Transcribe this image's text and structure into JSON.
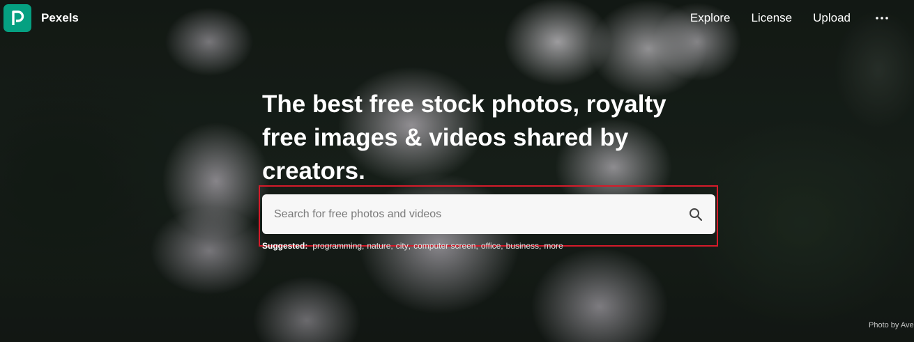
{
  "brand": {
    "name": "Pexels",
    "logo_icon": "pexels-logo-icon",
    "accent": "#05a081"
  },
  "nav": {
    "links": [
      "Explore",
      "License",
      "Upload"
    ],
    "more_icon": "more-horizontal-icon"
  },
  "hero": {
    "headline_lines": [
      "The best free stock photos, royalty",
      "free images & videos shared by",
      "creators."
    ],
    "search": {
      "placeholder": "Search for free photos and videos",
      "value": "",
      "icon": "search-icon"
    },
    "suggested": {
      "label": "Suggested:",
      "items": [
        "programming",
        "nature",
        "city",
        "computer screen",
        "office",
        "business",
        "more"
      ]
    },
    "credit": "Photo by Ave"
  },
  "colors": {
    "highlight_border": "#d51b2a"
  }
}
